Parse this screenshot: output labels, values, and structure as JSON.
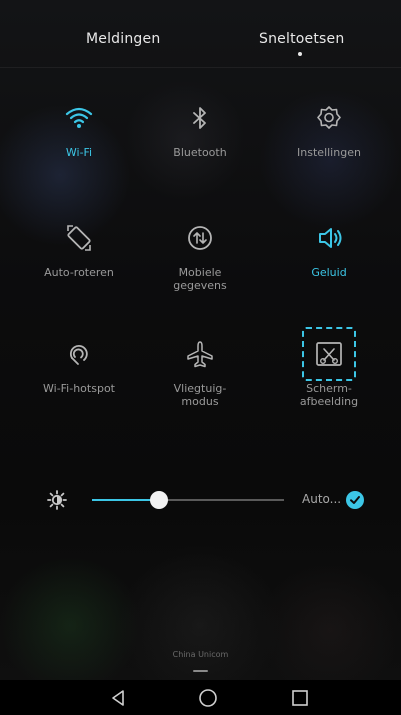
{
  "tabs": {
    "notifications": "Meldingen",
    "shortcuts": "Sneltoetsen",
    "active": "shortcuts"
  },
  "toggles": [
    {
      "label": "Wi-Fi",
      "icon": "wifi-icon",
      "active": true
    },
    {
      "label": "Bluetooth",
      "icon": "bluetooth-icon",
      "active": false
    },
    {
      "label": "Instellingen",
      "icon": "gear-icon",
      "active": false
    },
    {
      "label": "Auto-roteren",
      "icon": "auto-rotate-icon",
      "active": false
    },
    {
      "label": "Mobiele\ngegevens",
      "icon": "mobile-data-icon",
      "active": false
    },
    {
      "label": "Geluid",
      "icon": "speaker-icon",
      "active": true
    },
    {
      "label": "Wi-Fi-hotspot",
      "icon": "hotspot-icon",
      "active": false
    },
    {
      "label": "Vliegtuig-\nmodus",
      "icon": "airplane-icon",
      "active": false
    },
    {
      "label": "Scherm-\nafbeelding",
      "icon": "screenshot-icon",
      "active": false,
      "highlighted": true
    }
  ],
  "brightness": {
    "level": 0.35,
    "auto_label": "Auto...",
    "auto_enabled": true
  },
  "carrier": "China Unicom",
  "navbar": {
    "back": "back-icon",
    "home": "home-icon",
    "recent": "recent-apps-icon"
  },
  "colors": {
    "accent": "#3cc6e6",
    "label_inactive": "#9a9a9a",
    "background": "#0c0c0d"
  }
}
